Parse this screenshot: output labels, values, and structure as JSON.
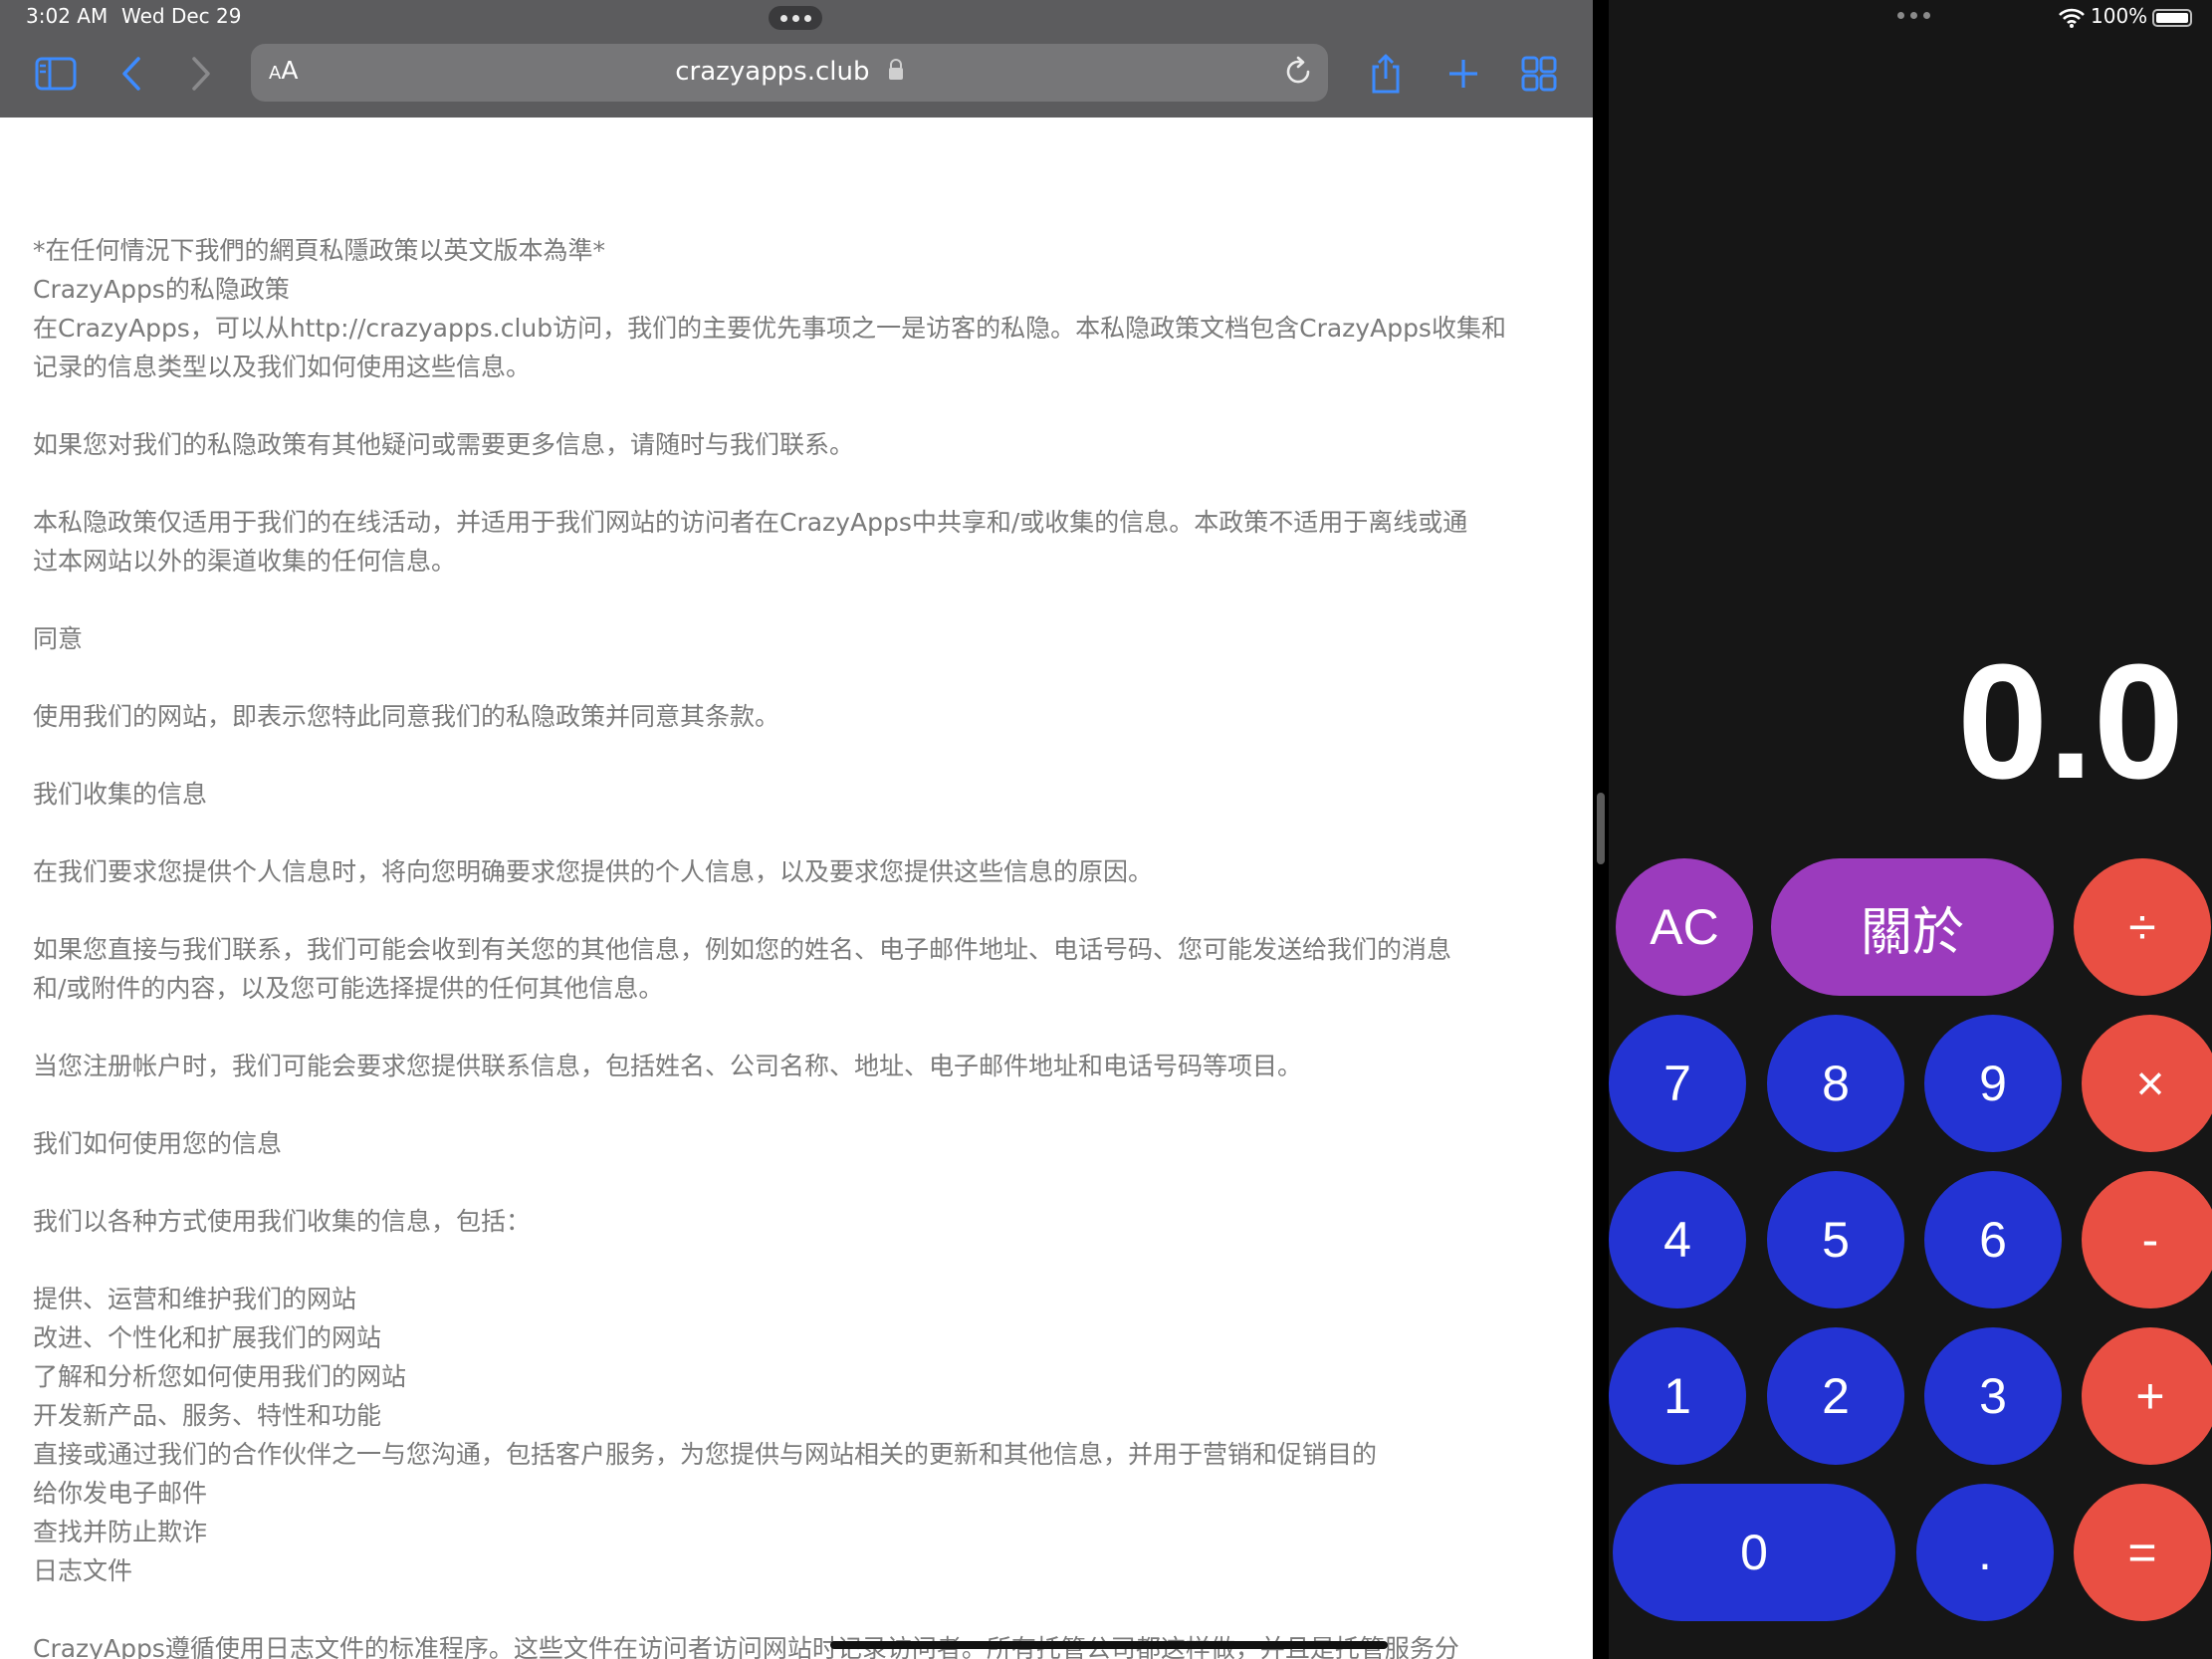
{
  "status_bar": {
    "time": "3:02 AM",
    "date": "Wed Dec 29",
    "battery": "100%"
  },
  "safari": {
    "aa_label_small": "A",
    "aa_label_large": "A",
    "url": "crazyapps.club",
    "icons": [
      "sidebar-icon",
      "back-icon",
      "forward-icon",
      "lock-icon",
      "reload-icon",
      "share-icon",
      "new-tab-icon",
      "tabs-overview-icon"
    ]
  },
  "page": {
    "lines": [
      "*在任何情況下我們的網頁私隱政策以英文版本為準*",
      "CrazyApps的私隐政策",
      "在CrazyApps，可以从http://crazyapps.club访问，我们的主要优先事项之一是访客的私隐。本私隐政策文档包含CrazyApps收集和",
      "记录的信息类型以及我们如何使用这些信息。",
      "",
      "如果您对我们的私隐政策有其他疑问或需要更多信息，请随时与我们联系。",
      "",
      "本私隐政策仅适用于我们的在线活动，并适用于我们网站的访问者在CrazyApps中共享和/或收集的信息。本政策不适用于离线或通",
      "过本网站以外的渠道收集的任何信息。",
      "",
      "同意",
      "",
      "使用我们的网站，即表示您特此同意我们的私隐政策并同意其条款。",
      "",
      "我们收集的信息",
      "",
      "在我们要求您提供个人信息时，将向您明确要求您提供的个人信息，以及要求您提供这些信息的原因。",
      "",
      "如果您直接与我们联系，我们可能会收到有关您的其他信息，例如您的姓名、电子邮件地址、电话号码、您可能发送给我们的消息",
      "和/或附件的内容，以及您可能选择提供的任何其他信息。",
      "",
      "当您注册帐户时，我们可能会要求您提供联系信息，包括姓名、公司名称、地址、电子邮件地址和电话号码等项目。",
      "",
      "我们如何使用您的信息",
      "",
      "我们以各种方式使用我们收集的信息，包括：",
      "",
      "提供、运营和维护我们的网站",
      "改进、个性化和扩展我们的网站",
      "了解和分析您如何使用我们的网站",
      "开发新产品、服务、特性和功能",
      "直接或通过我们的合作伙伴之一与您沟通，包括客户服务，为您提供与网站相关的更新和其他信息，并用于营销和促销目的",
      "给你发电子邮件",
      "查找并防止欺诈",
      "日志文件",
      "",
      "CrazyApps遵循使用日志文件的标准程序。这些文件在访问者访问网站时记录访问者。所有托管公司都这样做，并且是托管服务分"
    ]
  },
  "calculator": {
    "display": "0.0",
    "keys": {
      "ac": "AC",
      "about": "關於",
      "divide": "÷",
      "multiply": "×",
      "minus": "-",
      "plus": "+",
      "equals": "=",
      "dot": ".",
      "d0": "0",
      "d1": "1",
      "d2": "2",
      "d3": "3",
      "d4": "4",
      "d5": "5",
      "d6": "6",
      "d7": "7",
      "d8": "8",
      "d9": "9"
    },
    "colors": {
      "number": "#2333d3",
      "operator": "#e94f43",
      "function": "#9b3bbd",
      "background": "#161616"
    }
  }
}
